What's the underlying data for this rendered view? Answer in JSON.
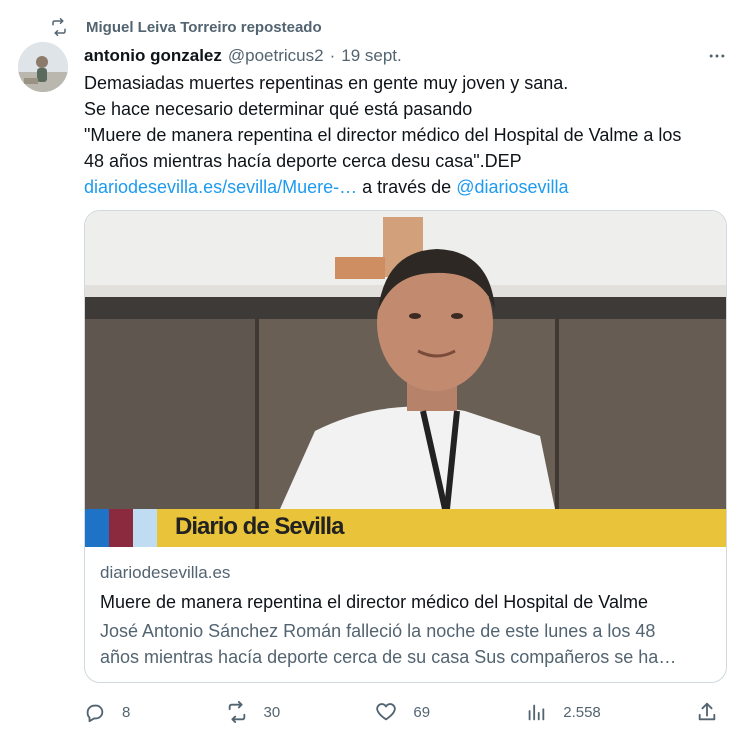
{
  "repost": {
    "text": "Miguel Leiva Torreiro reposteado"
  },
  "author": {
    "name": "antonio gonzalez",
    "handle": "@poetricus2",
    "separator": "·",
    "date": "19 sept."
  },
  "tweet": {
    "lines": [
      "Demasiadas muertes repentinas en gente muy joven y sana.",
      "Se hace necesario determinar qué está pasando",
      "\"Muere de manera repentina el director médico del Hospital de Valme a los",
      "48 años mientras hacía deporte cerca desu casa\".DEP"
    ],
    "link_text": "diariodesevilla.es/sevilla/Muere-…",
    "via_text": " a través de ",
    "mention": "@diariosevilla"
  },
  "card": {
    "image_banner_text": "Diario de Sevilla",
    "banner_colors": [
      "#1f73c7",
      "#8b2a3e",
      "#bfdcf2",
      "#e9c43a"
    ],
    "domain": "diariodesevilla.es",
    "title": "Muere de manera repentina el director médico del Hospital de Valme",
    "description_lines": [
      "José Antonio Sánchez Román falleció la noche de este lunes a los 48",
      "años mientras hacía deporte cerca de su casa Sus compañeros se ha…"
    ]
  },
  "actions": {
    "replies": "8",
    "reposts": "30",
    "likes": "69",
    "views": "2.558"
  },
  "colors": {
    "accent": "#1d9bf0",
    "secondary_text": "#536471",
    "border": "#cfd9de"
  }
}
